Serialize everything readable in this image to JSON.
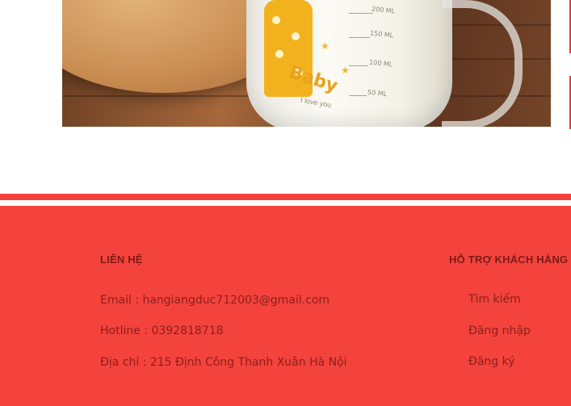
{
  "product_image": {
    "cup_brand_text": "Baby",
    "cup_tagline": "I love you",
    "cup_scale_labels": [
      "200 ML",
      "150 ML",
      "100 ML",
      "50 ML"
    ]
  },
  "footer": {
    "contact": {
      "heading": "LIÊN HỆ",
      "email": "Email : hangiangduc712003@gmail.com",
      "hotline": "Hotline : 0392818718",
      "address": "Địa chỉ : 215 Định Công Thanh Xuân Hà Nội"
    },
    "support": {
      "heading": "HỖ TRỢ KHÁCH HÀNG",
      "links": [
        "Tìm kiếm",
        "Đăng  nhập",
        "Đăng ký"
      ]
    }
  },
  "colors": {
    "footer_background": "#f4433c",
    "footer_text": "#8b1f1a",
    "heading_text": "#7a1c1a"
  }
}
